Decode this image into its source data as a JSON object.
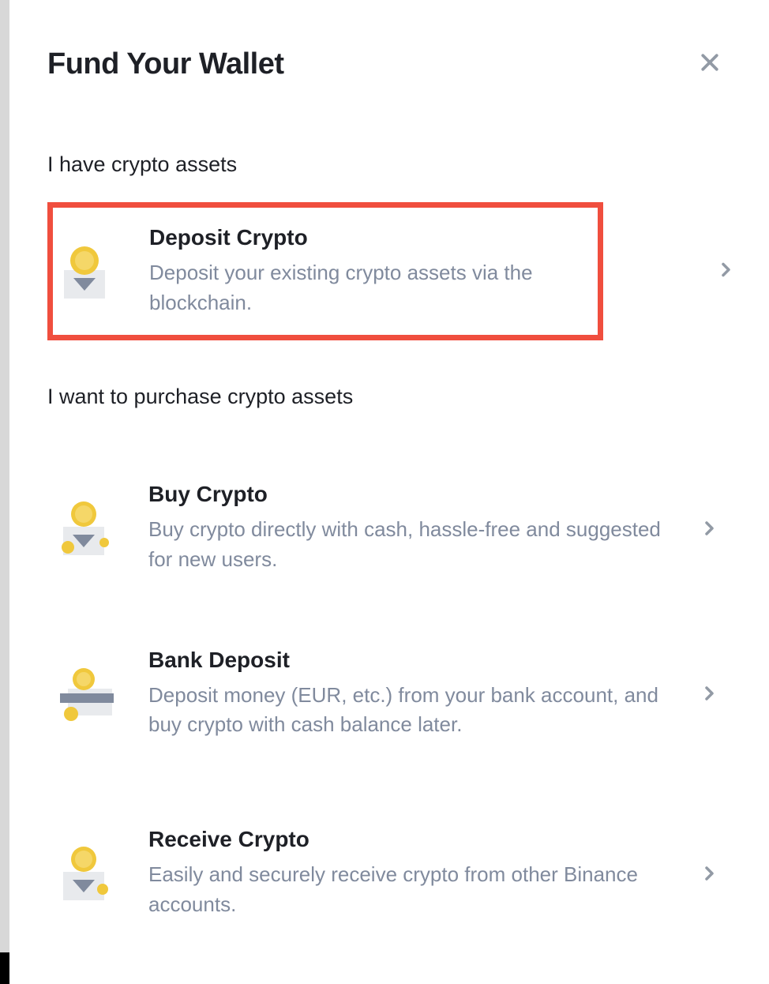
{
  "header": {
    "title": "Fund Your Wallet"
  },
  "sections": {
    "have_assets": {
      "label": "I have crypto assets",
      "options": {
        "deposit_crypto": {
          "title": "Deposit Crypto",
          "desc": "Deposit your existing crypto assets via the blockchain."
        }
      }
    },
    "purchase": {
      "label": "I want to purchase crypto assets",
      "options": {
        "buy_crypto": {
          "title": "Buy Crypto",
          "desc": "Buy crypto directly with cash, hassle-free and suggested for new users."
        },
        "bank_deposit": {
          "title": "Bank Deposit",
          "desc": "Deposit money (EUR, etc.) from your bank account, and buy crypto with cash balance later."
        },
        "receive_crypto": {
          "title": "Receive Crypto",
          "desc": "Easily and securely receive crypto from other Binance accounts."
        }
      }
    }
  }
}
